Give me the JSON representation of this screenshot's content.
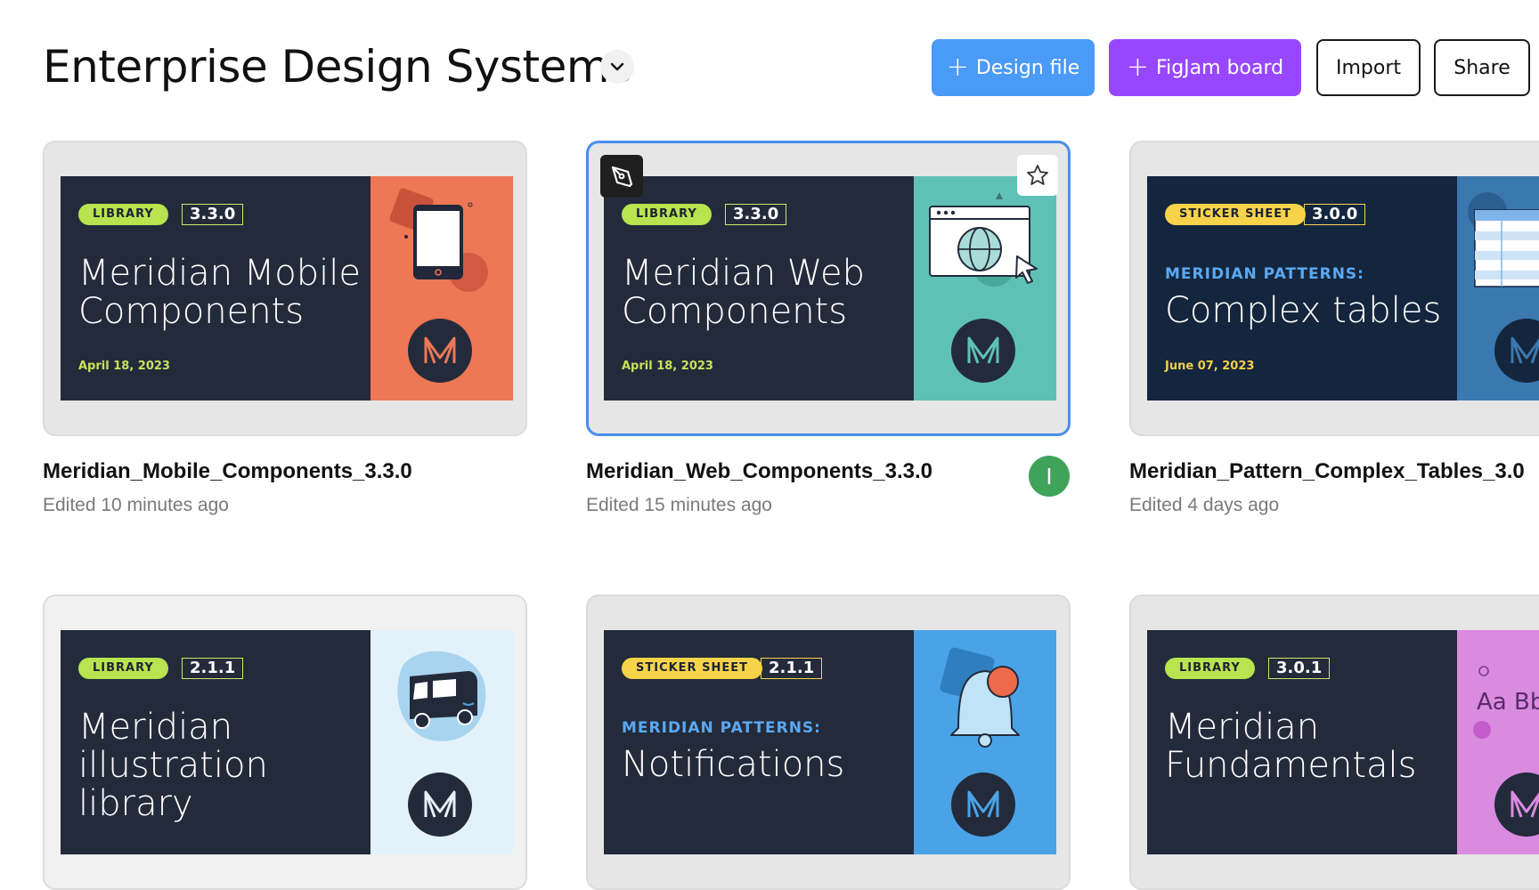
{
  "header": {
    "title": "Enterprise Design Systems",
    "buttons": {
      "design_file": "Design file",
      "figjam_board": "FigJam board",
      "import": "Import",
      "share": "Share"
    }
  },
  "files": [
    {
      "tag": "LIBRARY",
      "version": "3.3.0",
      "subtitle": "",
      "title": "Meridian Mobile Components",
      "date": "April 18, 2023",
      "name": "Meridian_Mobile_Components_3.3.0",
      "edited": "Edited 10 minutes ago"
    },
    {
      "tag": "LIBRARY",
      "version": "3.3.0",
      "subtitle": "",
      "title": "Meridian Web Components",
      "date": "April 18, 2023",
      "name": "Meridian_Web_Components_3.3.0",
      "edited": "Edited 15 minutes ago",
      "avatar": "I"
    },
    {
      "tag": "STICKER SHEET",
      "version": "3.0.0",
      "subtitle": "MERIDIAN PATTERNS:",
      "title": "Complex tables",
      "date": "June 07, 2023",
      "name": "Meridian_Pattern_Complex_Tables_3.0",
      "edited": "Edited 4 days ago"
    },
    {
      "tag": "LIBRARY",
      "version": "2.1.1",
      "subtitle": "",
      "title": "Meridian illustration library"
    },
    {
      "tag": "STICKER SHEET",
      "version": "2.1.1",
      "subtitle": "MERIDIAN PATTERNS:",
      "title": "Notifications"
    },
    {
      "tag": "LIBRARY",
      "version": "3.0.1",
      "subtitle": "",
      "title": "Meridian Fundamentals",
      "art_text": "Aa Bb"
    }
  ],
  "colors": {
    "accent_blue": "#4a9af7",
    "figjam_purple": "#9747ff",
    "thumb_navy": "#232b3b",
    "thumb_deep_navy": "#14263d",
    "library_tag": "#b9e34f",
    "sticker_tag": "#f7d34a",
    "date_green": "#c9e05a",
    "date_yellow": "#f5cf45"
  },
  "icons": [
    "chevron-down-icon",
    "plus-icon",
    "pen-tool-icon",
    "star-icon",
    "meridian-logo-icon",
    "phone-icon",
    "browser-globe-icon",
    "table-icon",
    "van-icon",
    "bell-icon",
    "typography-icon"
  ]
}
